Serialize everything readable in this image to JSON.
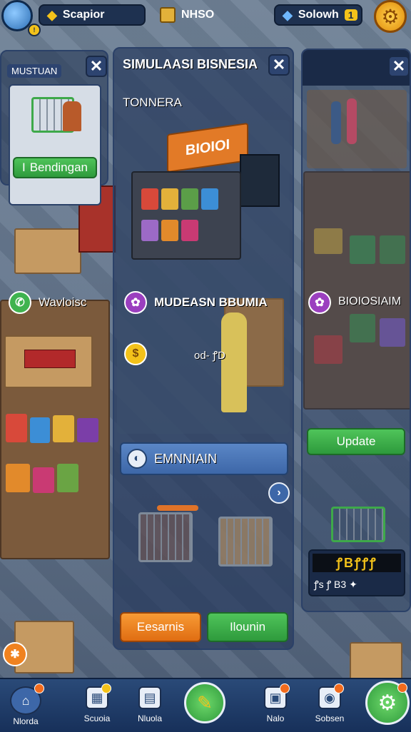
{
  "top_bar": {
    "resource_1": "Scapior",
    "resource_2": "NHSO",
    "resource_3": "Solowh",
    "resource_3_badge": "1"
  },
  "left_panel": {
    "header": "MUSTUAN",
    "button_label": "Bendingan",
    "button_prefix": "I",
    "status_label": "Wavloisc"
  },
  "center_panel": {
    "title": "SIMULAASI BISNESIA",
    "subtitle": "TONNERA",
    "store_sign": "BIOIOI",
    "row_1_label": "MUDEASN BBUMIA",
    "row_2_value": "od- ꝭD",
    "section_label": "EMNNIAIN",
    "button_left": "Eesarnis",
    "button_right": "Ilounin"
  },
  "right_panel": {
    "row_label": "BIOIOSIAIM",
    "update_label": "Update",
    "score_text": "ꝭBꝭꝭꝭ",
    "score_sub": "ꝭs ꝭ B3 ✦"
  },
  "bottom_nav": [
    {
      "label": "Nlorda",
      "icon": "home-icon"
    },
    {
      "label": "Scuoia",
      "icon": "store-icon"
    },
    {
      "label": "Nluola",
      "icon": "shop-icon"
    },
    {
      "label": "",
      "icon": "pencil-icon"
    },
    {
      "label": "Nalo",
      "icon": "box-icon"
    },
    {
      "label": "Sobsen",
      "icon": "camera-icon"
    },
    {
      "label": "",
      "icon": "gear-icon"
    }
  ],
  "colors": {
    "accent_green": "#3fb34f",
    "accent_orange": "#f0821f",
    "panel_blue": "#26395c",
    "gold": "#f3c21a"
  }
}
